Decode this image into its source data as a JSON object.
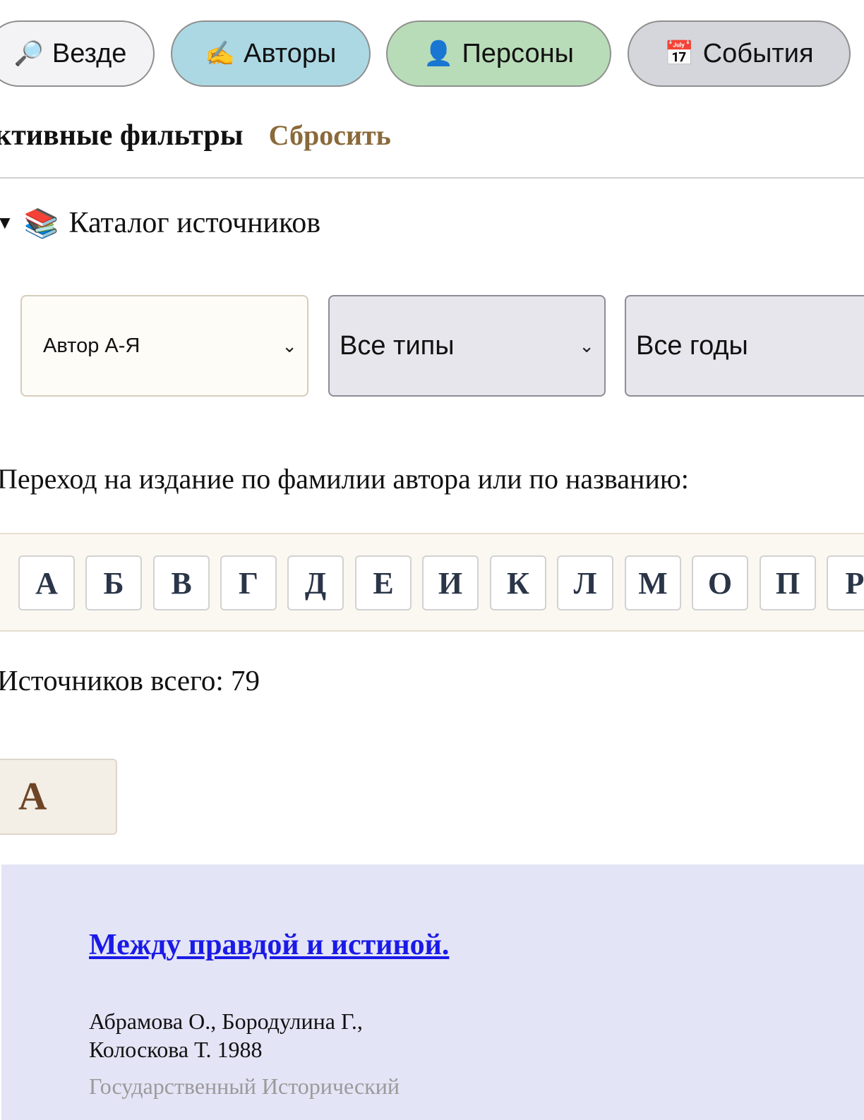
{
  "scopes": [
    {
      "icon": "🔎",
      "label": "Везде"
    },
    {
      "icon": "✍",
      "label": "Авторы"
    },
    {
      "icon": "👤",
      "label": "Персоны"
    },
    {
      "icon": "📅",
      "label": "События"
    }
  ],
  "filters": {
    "label": "ктивные фильтры",
    "reset": "Сбросить"
  },
  "catalog": {
    "title": "Каталог источников",
    "sort_select": "Автор А-Я",
    "type_select": "Все типы",
    "year_select": "Все годы",
    "jump_text": "Переход на издание по фамилии автора или по названию:",
    "letters": [
      "А",
      "Б",
      "В",
      "Г",
      "Д",
      "Е",
      "И",
      "К",
      "Л",
      "М",
      "О",
      "П",
      "Р"
    ],
    "total_text": "Источников всего: 79",
    "section_letter": "А"
  },
  "source": {
    "title": "Между правдой и истиной.",
    "authors_line1": "Абрамова О., Бородулина Г.,",
    "authors_line2": "Колоскова Т. 1988",
    "publisher": "Государственный Исторический"
  }
}
